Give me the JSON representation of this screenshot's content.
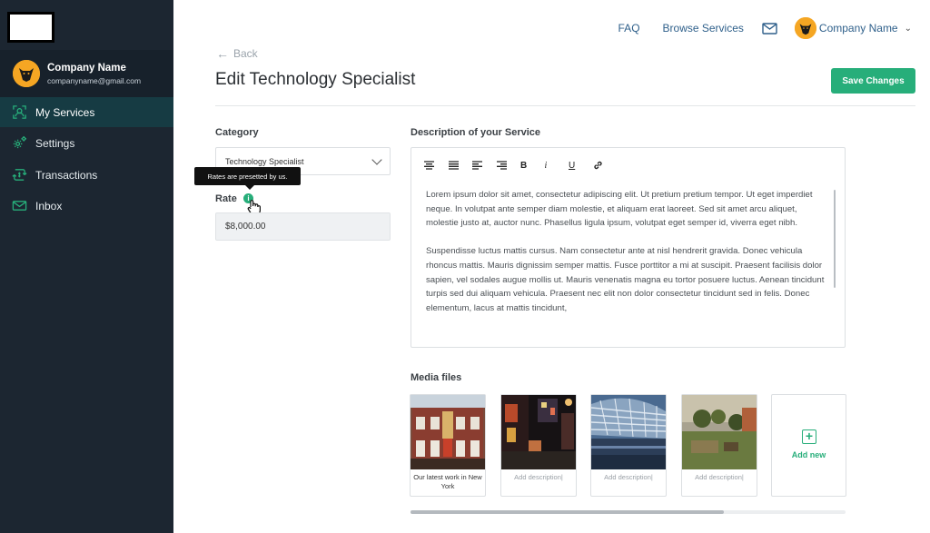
{
  "colors": {
    "accent": "#27ae7a",
    "sidebar": "#1c2631",
    "sidebar_active": "#163b43",
    "link": "#2e5f8a"
  },
  "sidebar": {
    "profile_name": "Company Name",
    "profile_email": "companyname@gmail.com",
    "items": [
      {
        "label": "My Services",
        "icon": "services-icon",
        "active": true
      },
      {
        "label": "Settings",
        "icon": "gear-icon",
        "active": false
      },
      {
        "label": "Transactions",
        "icon": "transactions-icon",
        "active": false
      },
      {
        "label": "Inbox",
        "icon": "mail-icon",
        "active": false
      }
    ]
  },
  "topnav": {
    "faq": "FAQ",
    "browse": "Browse Services",
    "account_name": "Company Name"
  },
  "header": {
    "back": "Back",
    "title": "Edit Technology Specialist",
    "save": "Save Changes"
  },
  "form": {
    "category_label": "Category",
    "category_value": "Technology Specialist",
    "tooltip": "Rates are presetted by us.",
    "rate_label": "Rate",
    "rate_value": "$8,000.00",
    "description_label": "Description of your Service",
    "toolbar": [
      "align-center-icon",
      "align-justify-icon",
      "align-left-icon",
      "align-right-icon",
      "bold-icon",
      "italic-icon",
      "underline-icon",
      "link-icon"
    ],
    "toolbar_glyphs": {
      "bold": "B",
      "italic": "i",
      "underline": "U"
    },
    "paragraphs": [
      "Lorem ipsum dolor sit amet, consectetur adipiscing elit. Ut pretium pretium tempor. Ut eget imperdiet neque. In volutpat ante semper diam molestie, et aliquam erat laoreet. Sed sit amet arcu aliquet, molestie justo at, auctor nunc. Phasellus ligula ipsum, volutpat eget semper id, viverra eget nibh.",
      "Suspendisse luctus mattis cursus. Nam consectetur ante at nisl hendrerit gravida. Donec vehicula rhoncus mattis. Mauris dignissim semper mattis. Fusce porttitor a mi at suscipit. Praesent facilisis dolor sapien, vel sodales augue mollis ut. Mauris venenatis magna eu tortor posuere luctus. Aenean tincidunt turpis sed dui aliquam vehicula. Praesent nec elit non dolor consectetur tincidunt sed in felis. Donec elementum, lacus at mattis tincidunt,"
    ]
  },
  "media": {
    "label": "Media files",
    "items": [
      {
        "caption": "Our latest work in New York",
        "placeholder": false
      },
      {
        "caption": "Add description|",
        "placeholder": true
      },
      {
        "caption": "Add description|",
        "placeholder": true
      },
      {
        "caption": "Add description|",
        "placeholder": true
      }
    ],
    "add_new": "Add new",
    "scroll_progress": 0.72
  }
}
